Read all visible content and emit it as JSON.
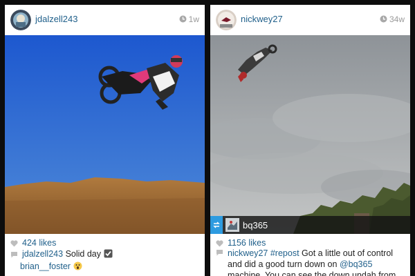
{
  "posts": [
    {
      "username": "jdalzell243",
      "time": "1w",
      "likes": "424 likes",
      "caption_user": "jdalzell243",
      "caption_text": "Solid day",
      "comment_user": "brian__foster",
      "icons": [
        "avatar",
        "clock-icon",
        "heart-icon",
        "comment-icon",
        "checkbox-emoji",
        "scared-emoji"
      ]
    },
    {
      "username": "nickwey27",
      "time": "34w",
      "likes": "1156 likes",
      "caption_user": "nickwey27",
      "caption_tag": "#repost",
      "caption_text_1": "Got a little out of control and did a good turn down on",
      "caption_mention": "@bq365",
      "caption_text_2": "machine. You can see the down undah from",
      "repost_user": "bq365",
      "icons": [
        "avatar",
        "clock-icon",
        "repost-icon",
        "heart-icon",
        "comment-icon"
      ]
    }
  ],
  "colors": {
    "link": "#1f5f8a",
    "sky_left": "#2a66d6",
    "sky_right": "#9aa0a6",
    "repost_badge": "#2d9be0"
  }
}
